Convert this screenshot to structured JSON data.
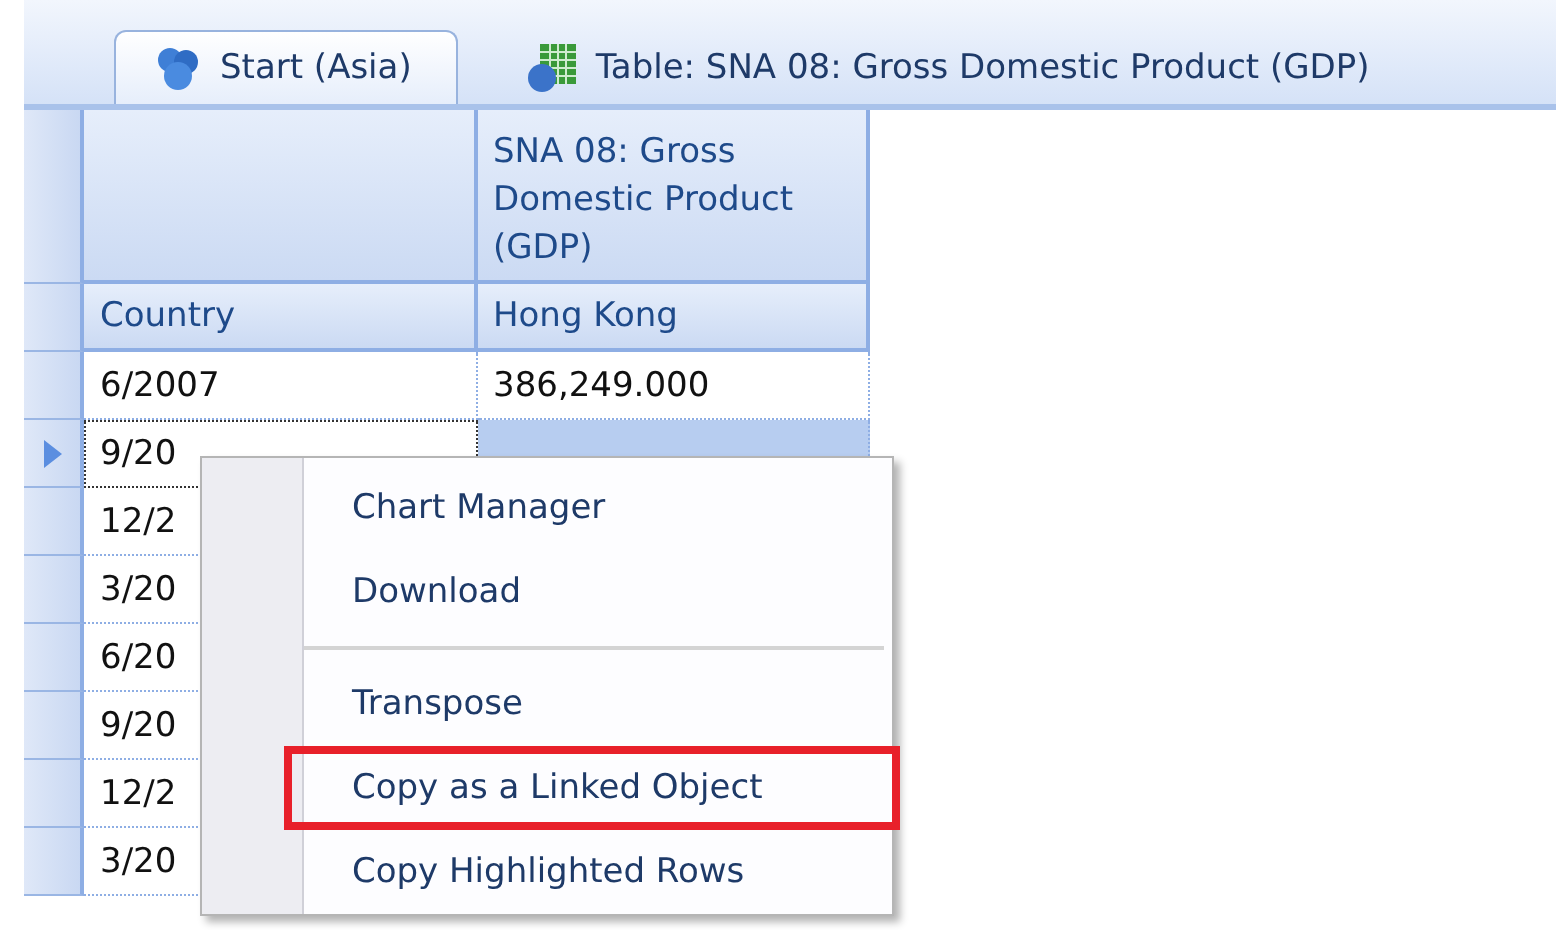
{
  "tabs": [
    {
      "label": "Start (Asia)",
      "selected": true,
      "kind": "start"
    },
    {
      "label": "Table: SNA 08: Gross Domestic Product (GDP)",
      "selected": false,
      "kind": "table"
    }
  ],
  "table": {
    "header_rows": [
      [
        "",
        "SNA 08: Gross Domestic Product (GDP)"
      ],
      [
        "Country",
        "Hong Kong"
      ]
    ],
    "rows": [
      {
        "cells": [
          "6/2007",
          "386,249.000"
        ],
        "selected": false
      },
      {
        "cells": [
          "9/20"
        ],
        "selected": true
      },
      {
        "cells": [
          "12/2"
        ],
        "selected": false
      },
      {
        "cells": [
          "3/20"
        ],
        "selected": false
      },
      {
        "cells": [
          "6/20"
        ],
        "selected": false
      },
      {
        "cells": [
          "9/20"
        ],
        "selected": false
      },
      {
        "cells": [
          "12/2"
        ],
        "selected": false
      },
      {
        "cells": [
          "3/20"
        ],
        "selected": false
      }
    ]
  },
  "context_menu": {
    "items": [
      {
        "kind": "item",
        "label": "Chart Manager",
        "highlighted": false
      },
      {
        "kind": "item",
        "label": "Download",
        "highlighted": false
      },
      {
        "kind": "separator"
      },
      {
        "kind": "item",
        "label": "Transpose",
        "highlighted": false
      },
      {
        "kind": "item",
        "label": "Copy as a Linked Object",
        "highlighted": true
      },
      {
        "kind": "item",
        "label": "Copy Highlighted Rows",
        "highlighted": false
      }
    ]
  }
}
